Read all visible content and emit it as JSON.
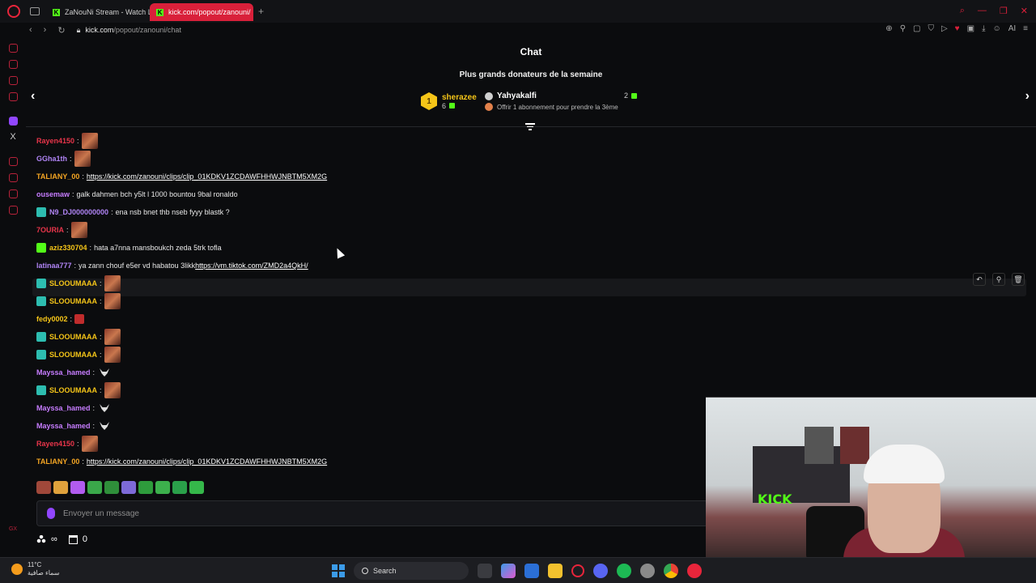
{
  "browser": {
    "tabs": [
      {
        "title": "ZaNouNi Stream - Watch L",
        "active": false
      },
      {
        "title": "kick.com/popout/zanouni/",
        "active": true
      }
    ],
    "url_host": "kick.com",
    "url_path": "/popout/zanouni/chat",
    "ai_label": "AI"
  },
  "chat": {
    "title": "Chat",
    "leaderboard_title": "Plus grands donateurs de la semaine",
    "donors": [
      {
        "rank": "1",
        "name": "sherazee",
        "count": "6"
      },
      {
        "name": "Yahyakalfi",
        "count": "2",
        "hint_rank": "3",
        "hint": "Offrir 1 abonnement pour prendre la 3ème"
      }
    ],
    "messages": [
      {
        "user": "Rayen4150",
        "color": "#e8354a",
        "text": "",
        "emote": "img",
        "sep": ":"
      },
      {
        "user": "GGha1th",
        "color": "#b084f5",
        "text": "",
        "emote": "img",
        "sep": ":"
      },
      {
        "user": "TALIANY_00",
        "color": "#f5a623",
        "text": "https://kick.com/zanouni/clips/clip_01KDKV1ZCDAWFHHWJNBTM5XM2G",
        "link": true,
        "sep": ":"
      },
      {
        "user": "ousemaw",
        "color": "#c77dff",
        "text": "galk dahmen bch y5lt l 1000 bountou 9bal ronaldo",
        "sep": ":"
      },
      {
        "user": "N9_DJ000000000",
        "color": "#b084f5",
        "text": "ena nsb bnet thb nseb fyyy blastk ?",
        "badge": "sub",
        "sep": ":"
      },
      {
        "user": "7OURIA",
        "color": "#e8354a",
        "text": "",
        "emote": "img",
        "sep": ":"
      },
      {
        "user": "aziz330704",
        "color": "#f5c518",
        "text": "hata a7nna mansboukch zeda 5trk tofla",
        "badge": "gift",
        "sep": ":"
      },
      {
        "user": "latinaa777",
        "color": "#b084f5",
        "text": "ya zann chouf e5er vd habatou 3likk",
        "link_text": "https://vm.tiktok.com/ZMD2a4QkH/",
        "sep": ":"
      },
      {
        "user": "SLOOUMAAA",
        "color": "#f5c518",
        "text": "",
        "emote": "img",
        "badge": "sub",
        "sep": ":"
      },
      {
        "user": "SLOOUMAAA",
        "color": "#f5c518",
        "text": "",
        "emote": "img",
        "badge": "sub",
        "sep": ":"
      },
      {
        "user": "fedy0002",
        "color": "#f5c518",
        "text": "",
        "emote": "sm",
        "sep": ":"
      },
      {
        "user": "SLOOUMAAA",
        "color": "#f5c518",
        "text": "",
        "emote": "img",
        "badge": "sub",
        "sep": ":"
      },
      {
        "user": "SLOOUMAAA",
        "color": "#f5c518",
        "text": "",
        "emote": "img",
        "badge": "sub",
        "sep": ":"
      },
      {
        "user": "Mayssa_hamed",
        "color": "#c77dff",
        "text": "",
        "emote": "cow",
        "sep": ":"
      },
      {
        "user": "SLOOUMAAA",
        "color": "#f5c518",
        "text": "",
        "emote": "img",
        "badge": "sub",
        "sep": ":"
      },
      {
        "user": "Mayssa_hamed",
        "color": "#c77dff",
        "text": "",
        "emote": "cow",
        "sep": ":"
      },
      {
        "user": "Mayssa_hamed",
        "color": "#c77dff",
        "text": "",
        "emote": "cow",
        "sep": ":"
      },
      {
        "user": "Rayen4150",
        "color": "#e8354a",
        "text": "",
        "emote": "img",
        "sep": ":"
      },
      {
        "user": "TALIANY_00",
        "color": "#f5a623",
        "text": "https://kick.com/zanouni/clips/clip_01KDKV1ZCDAWFHHWJNBTM5XM2G",
        "link": true,
        "sep": ":"
      }
    ],
    "input_placeholder": "Envoyer un message",
    "footer_points": "0"
  },
  "taskbar": {
    "temp": "11°C",
    "weather_text": "سماء صافية",
    "search_label": "Search"
  },
  "colors": {
    "accent": "#53fc18",
    "opera_red": "#d9203a"
  }
}
